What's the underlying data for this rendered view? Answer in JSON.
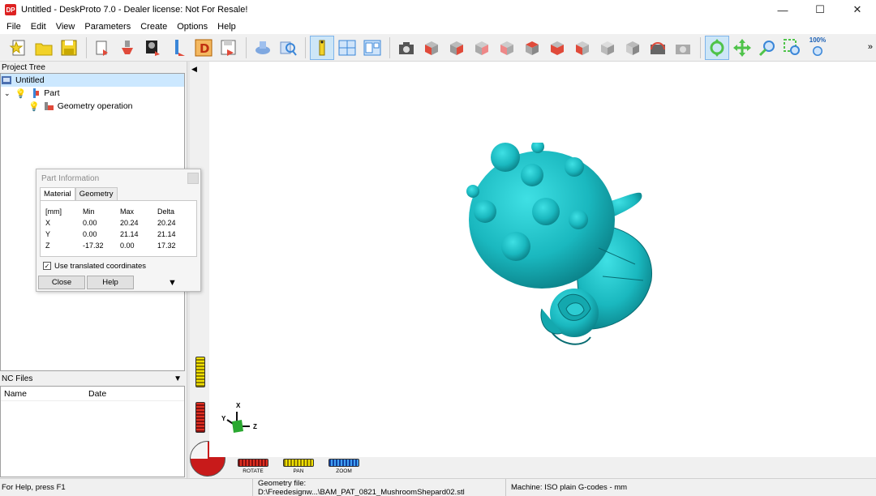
{
  "window": {
    "app_icon_text": "DP",
    "title": "Untitled - DeskProto 7.0 - Dealer license: Not For Resale!",
    "minimize": "—",
    "maximize": "☐",
    "close": "✕"
  },
  "menu": [
    "File",
    "Edit",
    "View",
    "Parameters",
    "Create",
    "Options",
    "Help"
  ],
  "toolbar": {
    "zoom_label": "100%",
    "more": "»",
    "colors": {
      "accent": "#7eb4ea",
      "green": "#4fc34a",
      "red": "#e04a3a",
      "blue": "#3a86d8",
      "yellow": "#f2d229"
    }
  },
  "project_tree": {
    "header": "Project Tree",
    "items": [
      {
        "label": "Untitled",
        "icon": "project-icon",
        "selected": true
      },
      {
        "label": "Part",
        "icon": "part-icon"
      },
      {
        "label": "Geometry operation",
        "icon": "geometry-operation-icon"
      }
    ]
  },
  "nc_files": {
    "header": "NC Files",
    "columns": [
      "Name",
      "Date"
    ]
  },
  "part_info": {
    "title": "Part Information",
    "tabs": [
      "Material",
      "Geometry"
    ],
    "active_tab": "Material",
    "headers": [
      "[mm]",
      "Min",
      "Max",
      "Delta"
    ],
    "rows": [
      {
        "axis": "X",
        "min": "0.00",
        "max": "20.24",
        "delta": "20.24"
      },
      {
        "axis": "Y",
        "min": "0.00",
        "max": "21.14",
        "delta": "21.14"
      },
      {
        "axis": "Z",
        "min": "-17.32",
        "max": "0.00",
        "delta": "17.32"
      }
    ],
    "translated_label": "Use translated coordinates",
    "translated_checked": true,
    "close_label": "Close",
    "help_label": "Help"
  },
  "viewport": {
    "model_color": "#1ab8bf",
    "nav": {
      "rotate": "ROTATE",
      "pan": "PAN",
      "zoom": "ZOOM"
    },
    "axes": {
      "x": "X",
      "y": "Y",
      "z": "Z"
    }
  },
  "status": {
    "help": "For Help, press F1",
    "geometry_file": "Geometry file: D:\\Freedesignw...\\BAM_PAT_0821_MushroomShepard02.stl",
    "machine": "Machine: ISO plain G-codes - mm"
  }
}
